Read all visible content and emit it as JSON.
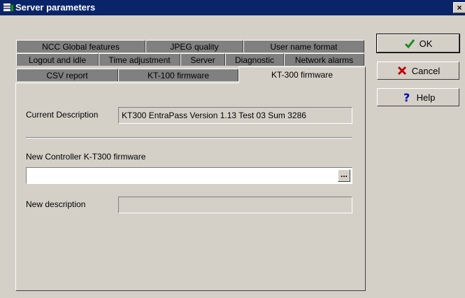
{
  "window": {
    "title": "Server parameters",
    "close_label": "×"
  },
  "tabs": {
    "row1": [
      "NCC Global features",
      "JPEG quality",
      "User name format"
    ],
    "row2": [
      "Logout and idle",
      "Time adjustment",
      "Server",
      "Diagnostic",
      "Network alarms"
    ],
    "row3": [
      "CSV report",
      "KT-100 firmware",
      "KT-300 firmware"
    ]
  },
  "panel": {
    "current_description_label": "Current Description",
    "current_description_value": "KT300 EntraPass Version 1.13 Test 03 Sum 3286",
    "new_firmware_label": "New Controller K-T300 firmware",
    "new_firmware_value": "",
    "browse_label": "...",
    "new_description_label": "New description",
    "new_description_value": ""
  },
  "buttons": {
    "ok": "OK",
    "cancel": "Cancel",
    "help": "Help"
  },
  "icons": {
    "ok": "check-icon",
    "cancel": "x-icon",
    "help": "question-icon"
  },
  "colors": {
    "titlebar": "#0a246a",
    "face": "#d4d0c8",
    "inactive_tab": "#808080"
  }
}
